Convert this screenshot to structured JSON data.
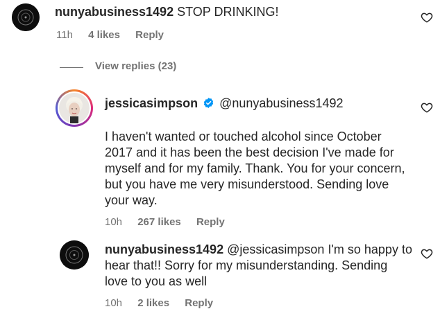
{
  "comments": [
    {
      "username": "nunyabusiness1492",
      "text": "STOP DRINKING!",
      "time": "11h",
      "likes": "4 likes",
      "reply_label": "Reply"
    }
  ],
  "view_replies": "View replies (23)",
  "replies": [
    {
      "username": "jessicasimpson",
      "verified": true,
      "mention": "@nunyabusiness1492",
      "text_lines": [
        "I haven't wanted or touched alcohol since October",
        "2017 and it has been the best decision I've made for",
        "myself and for my family. Thank. You for your concern,",
        "but you have me very misunderstood. Sending love",
        "your way."
      ],
      "time": "10h",
      "likes": "267 likes",
      "reply_label": "Reply"
    },
    {
      "username": "nunyabusiness1492",
      "mention": "@jessicasimpson",
      "first_line_text": "I'm so happy to",
      "text_lines": [
        "hear that!! Sorry for my misunderstanding. Sending",
        "love to you as well"
      ],
      "time": "10h",
      "likes": "2 likes",
      "reply_label": "Reply"
    }
  ],
  "colors": {
    "text": "#262626",
    "meta": "#737373",
    "verified": "#0095f6"
  },
  "icons": [
    "heart-icon",
    "verified-badge-icon"
  ]
}
